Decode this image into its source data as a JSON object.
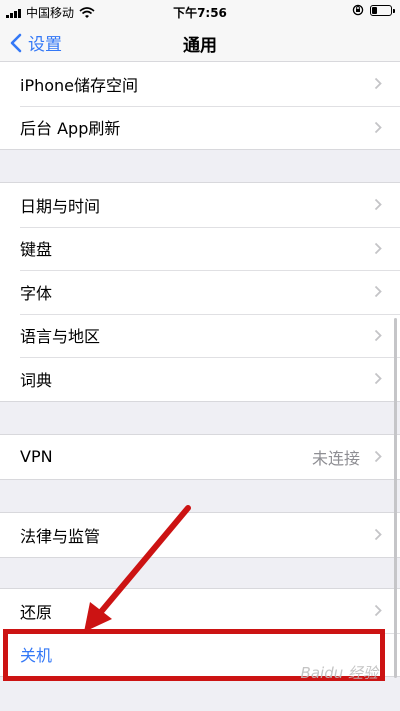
{
  "status_bar": {
    "carrier": "中国移动",
    "time": "下午7:56",
    "battery_level": 0.3
  },
  "nav": {
    "back_label": "设置",
    "title": "通用"
  },
  "groups": [
    [
      {
        "label": "iPhone储存空间"
      },
      {
        "label": "后台 App刷新"
      }
    ],
    [
      {
        "label": "日期与时间"
      },
      {
        "label": "键盘"
      },
      {
        "label": "字体"
      },
      {
        "label": "语言与地区"
      },
      {
        "label": "词典"
      }
    ],
    [
      {
        "label": "VPN",
        "value": "未连接"
      }
    ],
    [
      {
        "label": "法律与监管"
      }
    ],
    [
      {
        "label": "还原"
      },
      {
        "label": "关机"
      }
    ]
  ],
  "watermark": "Baidu 经验",
  "colors": {
    "accent": "#3478f6",
    "annotation": "#cc1313",
    "background": "#efeff4"
  },
  "icons": {
    "signal": "signal-bars-icon",
    "wifi": "wifi-icon",
    "lock_rotation": "orientation-lock-icon",
    "battery": "battery-icon",
    "back": "chevron-left-icon",
    "row": "chevron-right-icon"
  }
}
